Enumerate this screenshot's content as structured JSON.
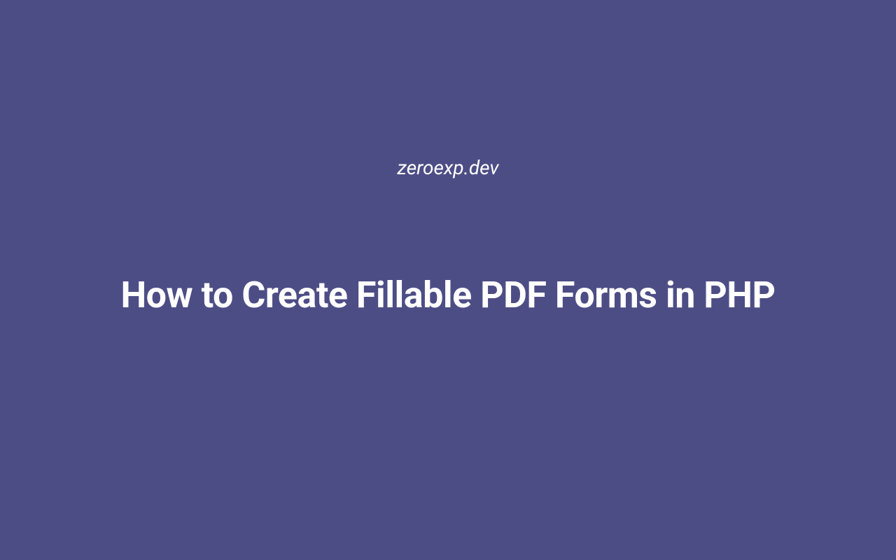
{
  "header": {
    "site_name": "zeroexp.dev"
  },
  "main": {
    "title": "How to Create Fillable PDF Forms in PHP"
  },
  "colors": {
    "background": "#4d4d86",
    "text": "#ffffff"
  }
}
